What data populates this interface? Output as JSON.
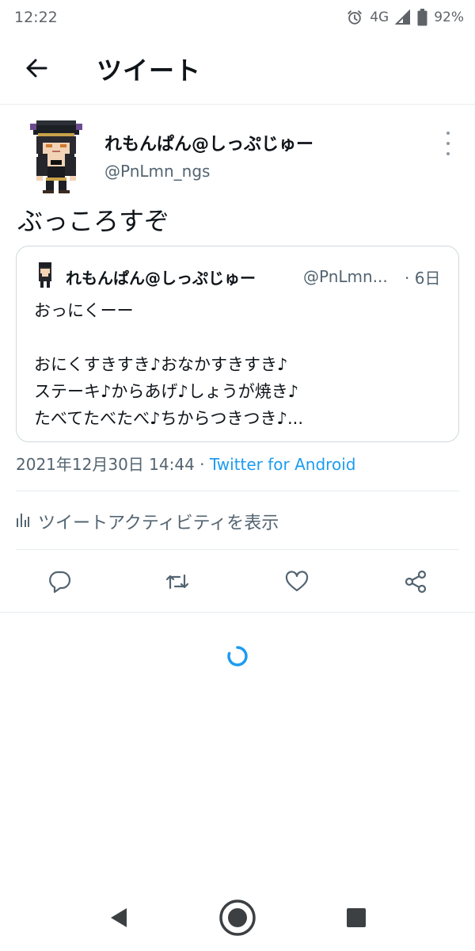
{
  "status_bar": {
    "time": "12:22",
    "network": "4G",
    "battery": "92%",
    "icons": [
      "alarm-icon",
      "signal-icon",
      "battery-icon"
    ]
  },
  "header": {
    "title": "ツイート",
    "back_icon": "arrow-left-icon"
  },
  "tweet": {
    "author_name": "れもんぱん@しっぷじゅー",
    "author_handle": "@PnLmn_ngs",
    "text": "ぶっころすぞ",
    "timestamp": "2021年12月30日 14:44",
    "separator": " · ",
    "source": "Twitter for Android",
    "activity_label": "ツイートアクティビティを表示"
  },
  "quoted_tweet": {
    "author_name": "れもんぱん@しっぷじゅー",
    "author_handle": "@PnLmn...",
    "time": "· 6日",
    "lines": [
      "おっにくーー",
      "",
      "おにくすきすき♪おなかすきすき♪",
      "ステーキ♪からあげ♪しょうが焼き♪",
      "たべてたべたべ♪ちからつきつき♪..."
    ]
  },
  "actions": [
    "reply-icon",
    "retweet-icon",
    "like-icon",
    "share-icon"
  ],
  "colors": {
    "accent": "#1d9bf0",
    "text_primary": "#0f1419",
    "text_secondary": "#536471",
    "border": "#cfd9de"
  }
}
